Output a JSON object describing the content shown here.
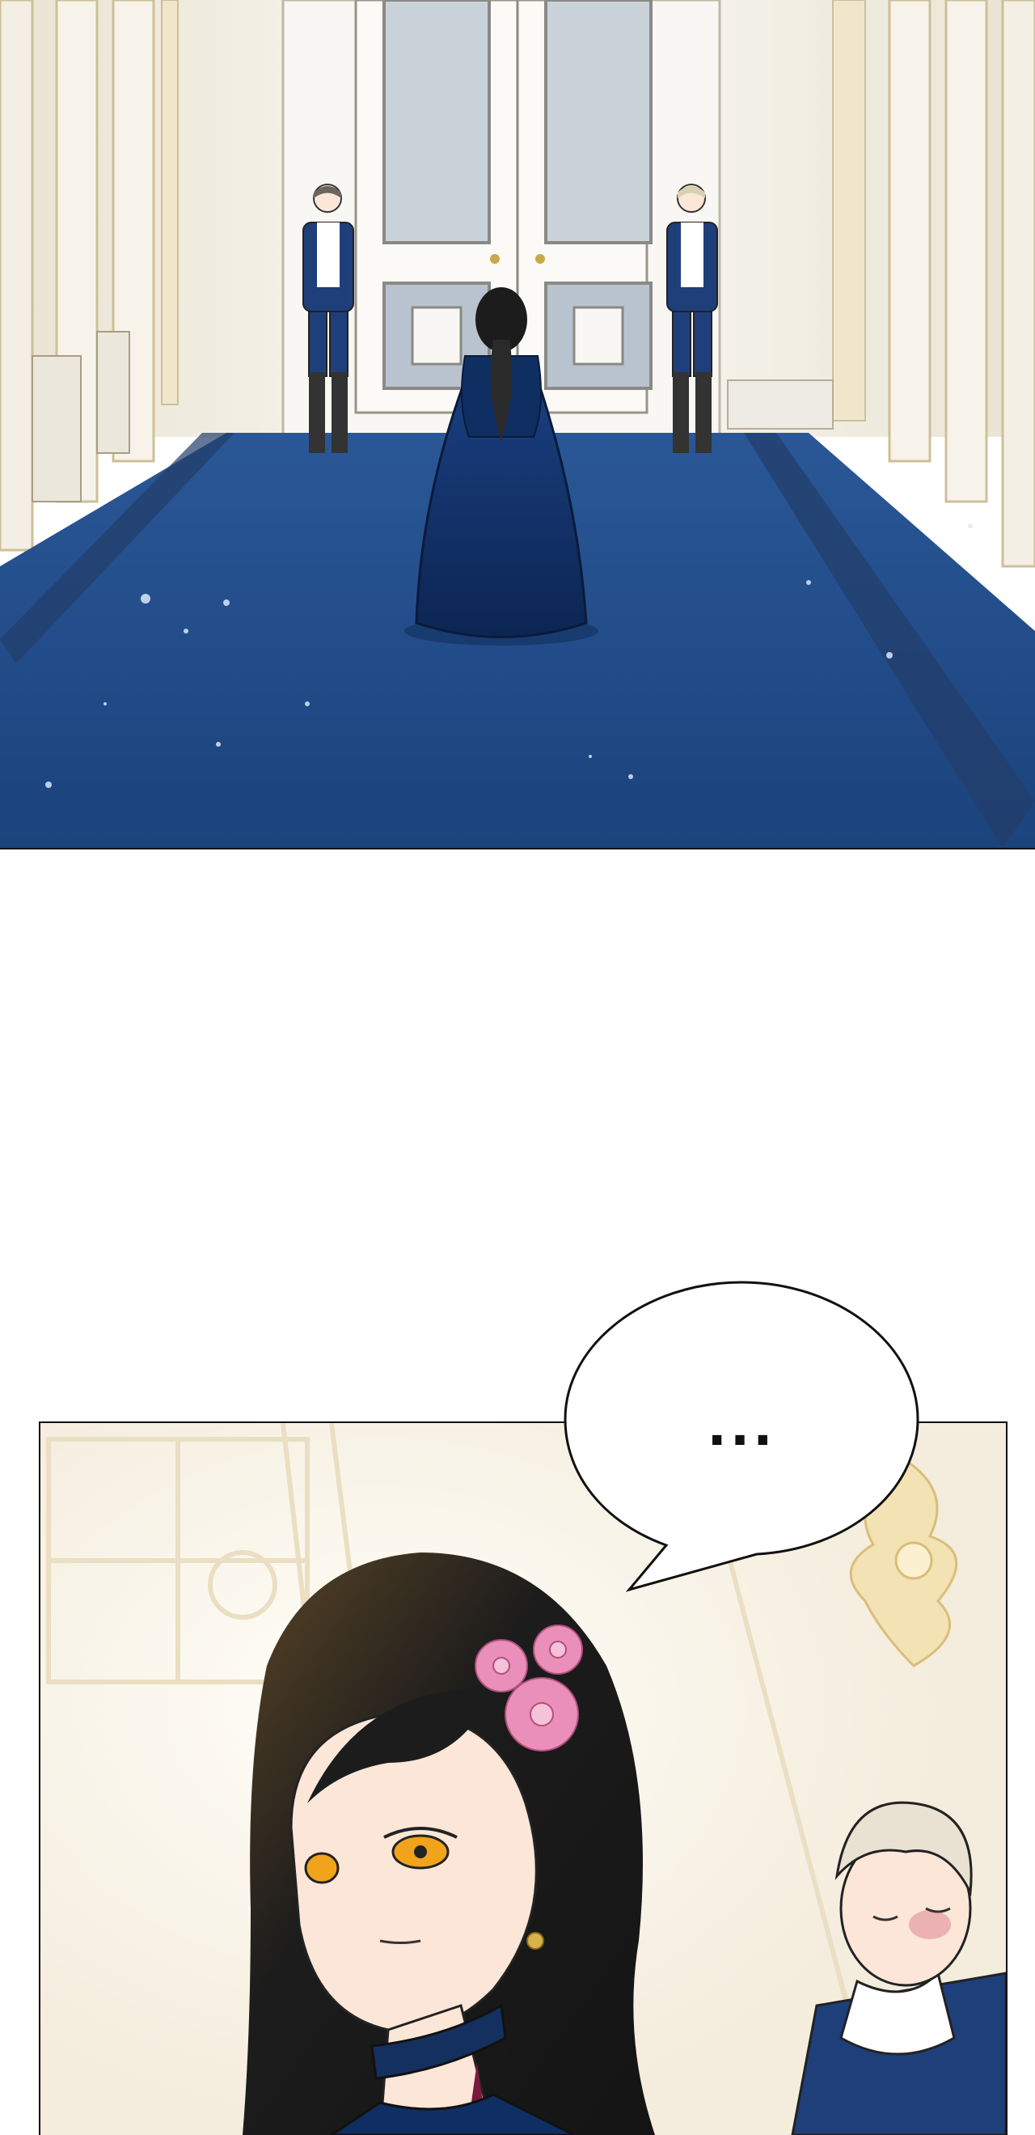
{
  "panels": [
    {
      "id": "panel-1",
      "description_name": "palace-hallway-panel"
    },
    {
      "id": "panel-2",
      "description_name": "woman-closeup-panel"
    }
  ],
  "speech_bubble": {
    "text": "..."
  },
  "colors": {
    "carpet": "#1e4a86",
    "carpet_dark": "#163a6e",
    "wall": "#f4f2ee",
    "gold": "#e6cf9a",
    "dress": "#0f2e62",
    "hair": "#1c1c1c",
    "flower": "#e98fb9",
    "uniform_blue": "#1f3f7a",
    "skin": "#fbe6d8",
    "eye": "#f0a31b"
  }
}
